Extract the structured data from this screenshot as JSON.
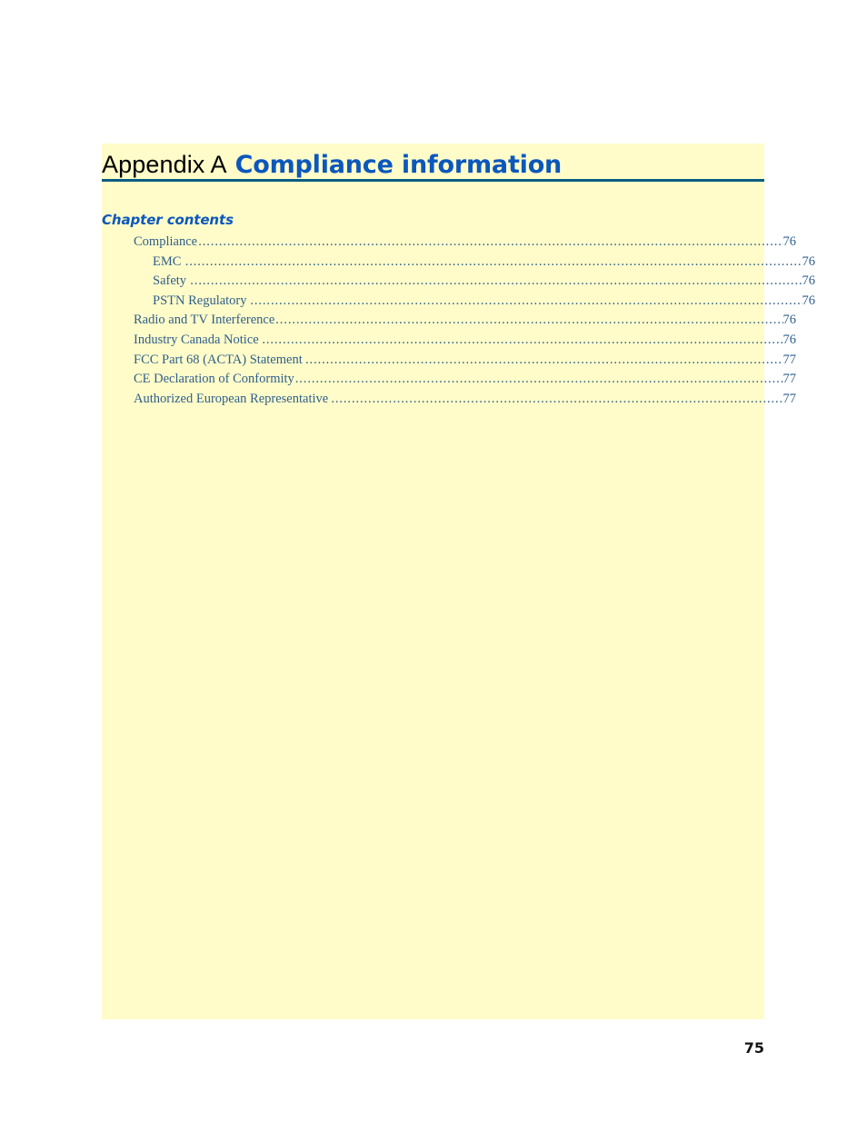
{
  "page": {
    "folio": "75",
    "background_color": "#ffffff",
    "block_tint_color": "#fffcc9",
    "rule_color": "#0a5d82",
    "accent_color": "#0b57bd",
    "toc_text_color": "#2f5f8c"
  },
  "header": {
    "appendix_label": "Appendix A",
    "appendix_title": "Compliance information"
  },
  "contents": {
    "heading": "Chapter contents",
    "entries": [
      {
        "label": "Compliance",
        "page": "76",
        "level": 1,
        "trailing_space": false
      },
      {
        "label": "EMC",
        "page": "76",
        "level": 2,
        "trailing_space": true
      },
      {
        "label": "Safety",
        "page": "76",
        "level": 2,
        "trailing_space": true
      },
      {
        "label": "PSTN Regulatory",
        "page": "76",
        "level": 2,
        "trailing_space": true
      },
      {
        "label": "Radio and TV Interference",
        "page": "76",
        "level": 1,
        "trailing_space": false
      },
      {
        "label": "Industry Canada Notice",
        "page": "76",
        "level": 1,
        "trailing_space": true
      },
      {
        "label": "FCC Part 68 (ACTA) Statement",
        "page": "77",
        "level": 1,
        "trailing_space": true
      },
      {
        "label": "CE Declaration of Conformity",
        "page": "77",
        "level": 1,
        "trailing_space": false
      },
      {
        "label": "Authorized European Representative",
        "page": "77",
        "level": 1,
        "trailing_space": true
      }
    ]
  }
}
